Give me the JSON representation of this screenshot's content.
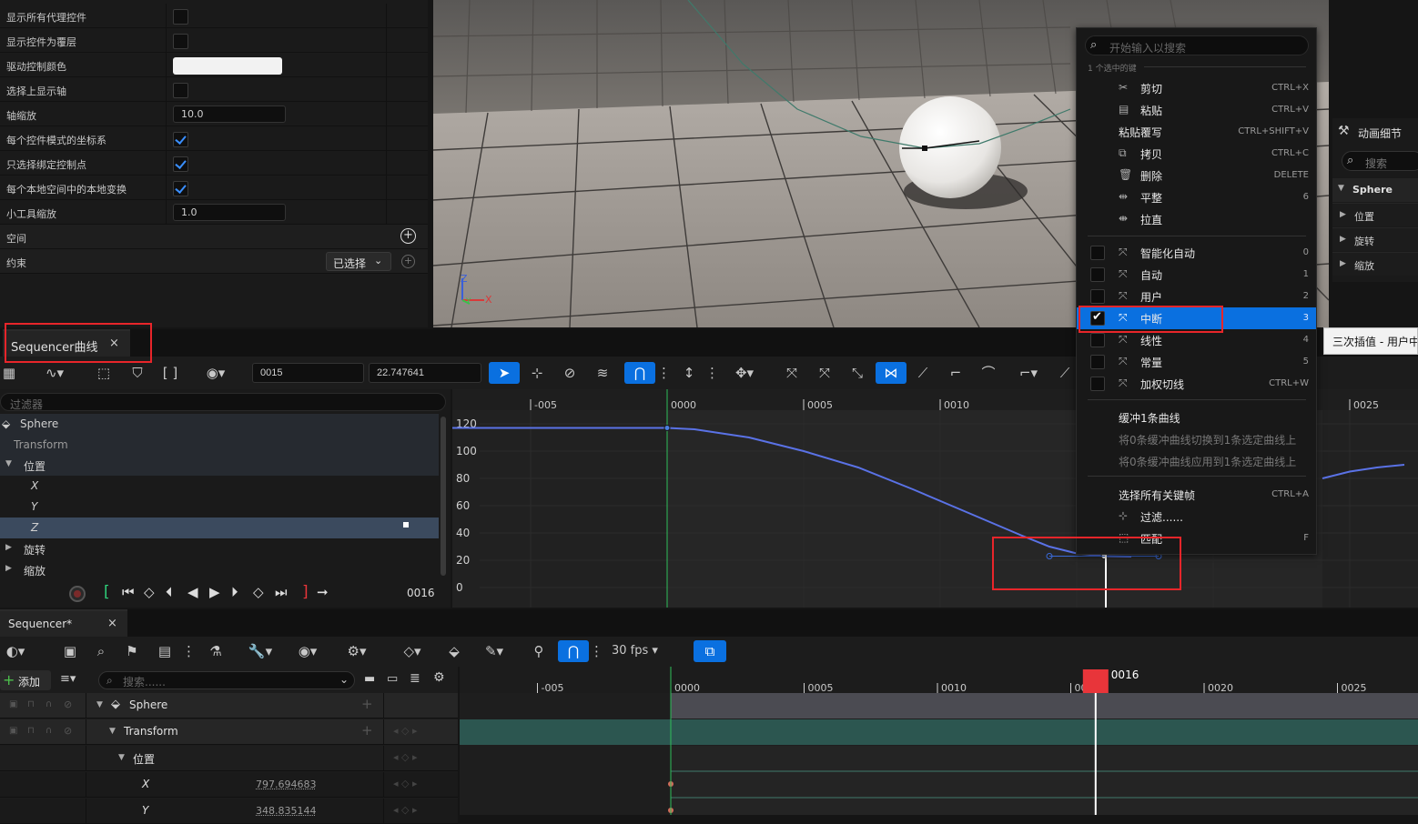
{
  "details": {
    "rows": [
      {
        "label": "显示所有代理控件",
        "kind": "checkbox",
        "checked": false
      },
      {
        "label": "显示控件为覆层",
        "kind": "checkbox",
        "checked": false
      },
      {
        "label": "驱动控制颜色",
        "kind": "color",
        "color": "#f2f2f2"
      },
      {
        "label": "选择上显示轴",
        "kind": "checkbox",
        "checked": false
      },
      {
        "label": "轴缩放",
        "kind": "number",
        "value": "10.0"
      },
      {
        "label": "每个控件模式的坐标系",
        "kind": "checkbox",
        "checked": true
      },
      {
        "label": "只选择绑定控制点",
        "kind": "checkbox",
        "checked": true
      },
      {
        "label": "每个本地空间中的本地变换",
        "kind": "checkbox",
        "checked": true
      },
      {
        "label": "小工具缩放",
        "kind": "number",
        "value": "1.0"
      }
    ],
    "space_label": "空间",
    "constraint_label": "约束",
    "constraint_value": "已选择"
  },
  "viewport": {
    "axis_z": "Z",
    "axis_x": "X",
    "axis_y": "Y"
  },
  "curve_editor": {
    "tab_label": "Sequencer曲线",
    "frame_field": "0015",
    "value_field": "22.747641",
    "filter_placeholder": "过滤器",
    "tree": [
      {
        "label": "Sphere",
        "indent": 0,
        "icon": "cube-icon"
      },
      {
        "label": "Transform",
        "indent": 1
      },
      {
        "label": "位置",
        "indent": 1,
        "expanded": true
      },
      {
        "label": "X",
        "indent": 2,
        "italic": true
      },
      {
        "label": "Y",
        "indent": 2,
        "italic": true
      },
      {
        "label": "Z",
        "indent": 2,
        "italic": true,
        "selected": true
      },
      {
        "label": "旋转",
        "indent": 1
      },
      {
        "label": "缩放",
        "indent": 1
      }
    ],
    "timeline_ticks": [
      "-005",
      "0000",
      "0005",
      "0010",
      "0015",
      "0020",
      "0025"
    ],
    "y_ticks": [
      "120",
      "100",
      "80",
      "60",
      "40",
      "20",
      "0"
    ],
    "current_frame": "0016"
  },
  "chart_data": {
    "type": "line",
    "xlabel": "",
    "ylabel": "",
    "xlim": [
      -10,
      27
    ],
    "ylim": [
      -5,
      125
    ],
    "series": [
      {
        "values": [
          [
            -10,
            117
          ],
          [
            0,
            117
          ],
          [
            1,
            116
          ],
          [
            3,
            110
          ],
          [
            5,
            100
          ],
          [
            7,
            88
          ],
          [
            9,
            72
          ],
          [
            11,
            55
          ],
          [
            13,
            38
          ],
          [
            14,
            30
          ],
          [
            15,
            25
          ],
          [
            16,
            23
          ],
          [
            17,
            22.7
          ]
        ]
      },
      {
        "values": [
          [
            24,
            80
          ],
          [
            25,
            85
          ],
          [
            26,
            88
          ],
          [
            27,
            90
          ]
        ]
      }
    ],
    "keys": [
      [
        0,
        117
      ],
      [
        16,
        23
      ]
    ]
  },
  "context_menu": {
    "search_placeholder": "开始输入以搜索",
    "section_label": "1 个选中的键",
    "edit_items": [
      {
        "label": "剪切",
        "shortcut": "CTRL+X",
        "icon": "cut-icon"
      },
      {
        "label": "粘贴",
        "shortcut": "CTRL+V",
        "icon": "paste-icon"
      },
      {
        "label": "粘贴覆写",
        "shortcut": "CTRL+SHIFT+V",
        "icon": ""
      },
      {
        "label": "拷贝",
        "shortcut": "CTRL+C",
        "icon": "copy-icon"
      },
      {
        "label": "删除",
        "shortcut": "DELETE",
        "icon": "trash-icon"
      },
      {
        "label": "平整",
        "shortcut": "6",
        "icon": "flatten-icon"
      },
      {
        "label": "拉直",
        "shortcut": "",
        "icon": "straighten-icon"
      }
    ],
    "interp_items": [
      {
        "label": "智能化自动",
        "shortcut": "0",
        "checked": false
      },
      {
        "label": "自动",
        "shortcut": "1",
        "checked": false
      },
      {
        "label": "用户",
        "shortcut": "2",
        "checked": false
      },
      {
        "label": "中断",
        "shortcut": "3",
        "checked": true
      },
      {
        "label": "线性",
        "shortcut": "4",
        "checked": false
      },
      {
        "label": "常量",
        "shortcut": "5",
        "checked": false
      },
      {
        "label": "加权切线",
        "shortcut": "CTRL+W",
        "checked": false
      }
    ],
    "buffer_items": [
      {
        "label": "缓冲1条曲线",
        "enabled": true
      },
      {
        "label": "将0条缓冲曲线切换到1条选定曲线上",
        "enabled": false
      },
      {
        "label": "将0条缓冲曲线应用到1条选定曲线上",
        "enabled": false
      }
    ],
    "select_all": {
      "label": "选择所有关键帧",
      "shortcut": "CTRL+A"
    },
    "filter": {
      "label": "过滤......"
    },
    "fit": {
      "label": "匹配",
      "shortcut": "F"
    }
  },
  "tooltip": "三次插值 - 用户中",
  "anim_details": {
    "title": "动画细节",
    "search_placeholder": "搜索",
    "object": "Sphere",
    "items": [
      "位置",
      "旋转",
      "缩放"
    ]
  },
  "sequencer": {
    "tab_label": "Sequencer*",
    "fps": "30 fps",
    "add_label": "添加",
    "search_placeholder": "搜索......",
    "tracks": [
      {
        "label": "Sphere",
        "indent": 0
      },
      {
        "label": "Transform",
        "indent": 1
      },
      {
        "label": "位置",
        "indent": 2
      },
      {
        "label": "X",
        "indent": 3,
        "value": "797.694683"
      },
      {
        "label": "Y",
        "indent": 3,
        "value": "348.835144"
      }
    ],
    "timeline_ticks": [
      "-005",
      "0000",
      "0005",
      "0010",
      "0015",
      "0020",
      "0025"
    ],
    "current_frame": "0016"
  },
  "colors": {
    "accent": "#0a70e0",
    "curve": "#5a72e6",
    "playhead": "#e8353a",
    "highlight": "#e8252a"
  }
}
